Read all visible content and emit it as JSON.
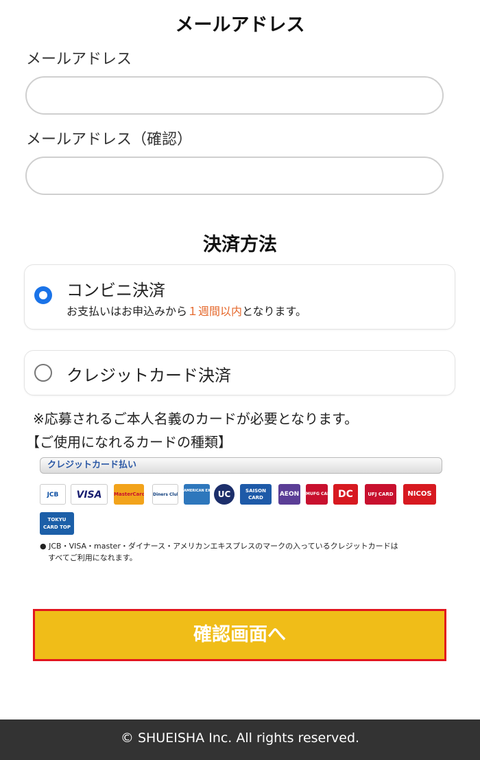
{
  "email_section": {
    "title": "メールアドレス",
    "email_label": "メールアドレス",
    "email_value": "",
    "email_placeholder": "",
    "confirm_label": "メールアドレス（確認）",
    "confirm_value": "",
    "confirm_placeholder": ""
  },
  "payment": {
    "title": "決済方法",
    "options": [
      {
        "label": "コンビニ決済",
        "selected": true,
        "sub_before": "お支払いはお申込みから",
        "sub_highlight": "１週間以内",
        "sub_after": "となります。"
      },
      {
        "label": "クレジットカード決済",
        "selected": false
      }
    ],
    "highlight_color": "#e5672a",
    "radio_color": "#1a73e8"
  },
  "card_info": {
    "notice": "※応募されるご本人名義のカードが必要となります。",
    "heading": "【ご使用になれるカードの種類】",
    "bar_label": "クレジットカード払い",
    "logos": [
      {
        "name": "jcb-logo",
        "text": "JCB"
      },
      {
        "name": "visa-logo",
        "text": "VISA"
      },
      {
        "name": "mastercard-logo",
        "text": "MasterCard"
      },
      {
        "name": "diners-logo",
        "text": "Diners Club"
      },
      {
        "name": "amex-logo",
        "text": "AMERICAN EXPRESS"
      },
      {
        "name": "uc-logo",
        "text": "UC"
      },
      {
        "name": "saison-logo",
        "text": "SAISON CARD"
      },
      {
        "name": "aeon-logo",
        "text": "AEON"
      },
      {
        "name": "mufg-logo",
        "text": "MUFG CARD"
      },
      {
        "name": "dc-logo",
        "text": "DC"
      },
      {
        "name": "ufj-logo",
        "text": "UFJ CARD"
      },
      {
        "name": "nicos-logo",
        "text": "NICOS"
      },
      {
        "name": "tokyu-logo",
        "text": "TOKYU CARD TOP"
      }
    ],
    "note_line1": "● JCB・VISA・master・ダイナース・アメリカンエキスプレスのマークの入っているクレジットカードは",
    "note_line2": "すべてご利用になれます。"
  },
  "confirm_button": "確認画面へ",
  "footer": "© SHUEISHA Inc. All rights reserved.",
  "colors": {
    "button_bg": "#f0bd18",
    "button_border": "#e2161e",
    "footer_bg": "#333333"
  }
}
